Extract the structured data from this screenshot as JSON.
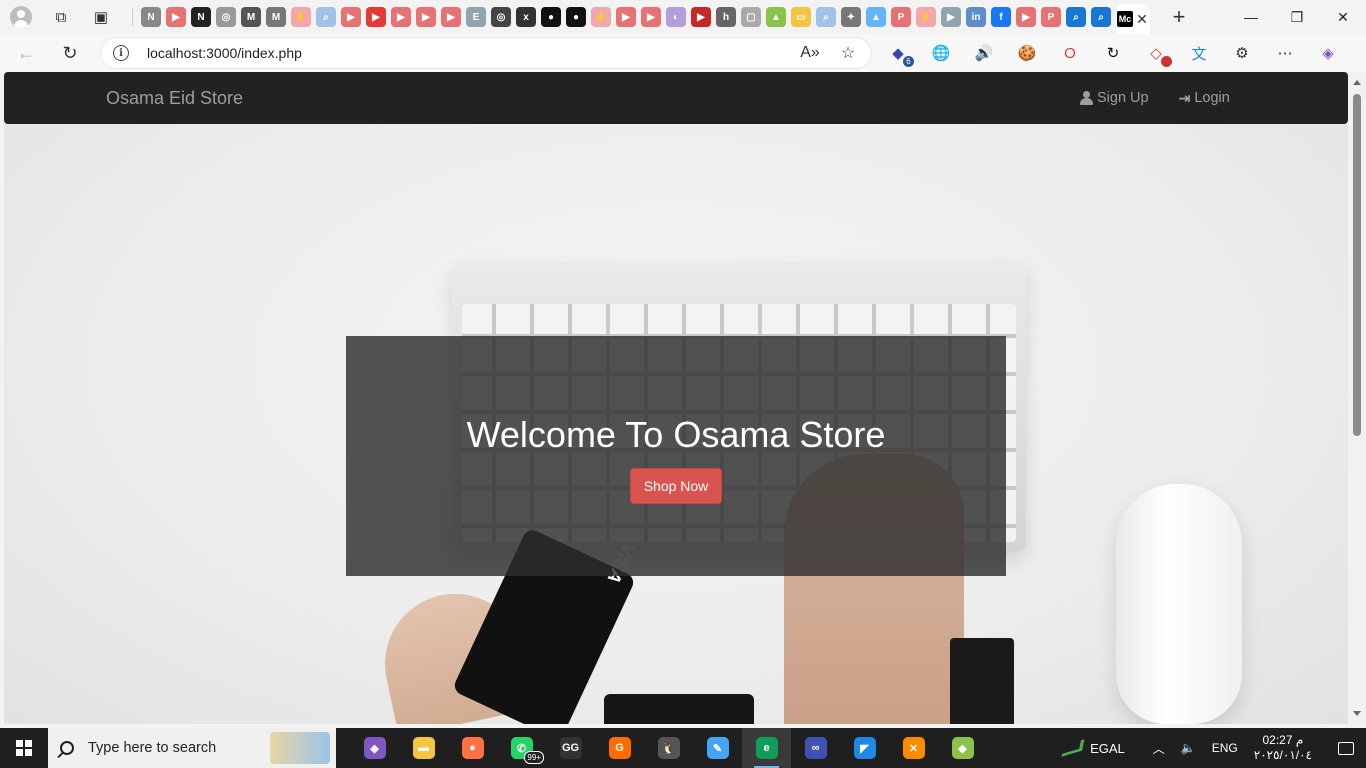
{
  "browser": {
    "url": "localhost:3000/index.php",
    "active_tab_favicon": "Mc",
    "pinned_tabs": [
      {
        "icon": "notion-icon",
        "color": "#888888",
        "glyph": "N"
      },
      {
        "icon": "youtube-icon",
        "color": "#e57373",
        "glyph": "▶"
      },
      {
        "icon": "notion-icon",
        "color": "#222222",
        "glyph": "N"
      },
      {
        "icon": "openai-icon",
        "color": "#999999",
        "glyph": "◎"
      },
      {
        "icon": "medium-icon",
        "color": "#555555",
        "glyph": "M"
      },
      {
        "icon": "medium-icon",
        "color": "#777777",
        "glyph": "M"
      },
      {
        "icon": "app-icon",
        "color": "#f0a8a8",
        "glyph": "⚡"
      },
      {
        "icon": "search-icon",
        "color": "#9ec3e6",
        "glyph": "⌕"
      },
      {
        "icon": "youtube-icon",
        "color": "#e57373",
        "glyph": "▶"
      },
      {
        "icon": "youtube-icon",
        "color": "#e53935",
        "glyph": "▶"
      },
      {
        "icon": "youtube-icon",
        "color": "#e57373",
        "glyph": "▶"
      },
      {
        "icon": "youtube-icon",
        "color": "#e57373",
        "glyph": "▶"
      },
      {
        "icon": "youtube-icon",
        "color": "#e57373",
        "glyph": "▶"
      },
      {
        "icon": "edge-icon",
        "color": "#90a4ae",
        "glyph": "E"
      },
      {
        "icon": "openai-icon",
        "color": "#444444",
        "glyph": "◎"
      },
      {
        "icon": "alx-icon",
        "color": "#333333",
        "glyph": "x"
      },
      {
        "icon": "github-icon",
        "color": "#111111",
        "glyph": "●"
      },
      {
        "icon": "github-icon",
        "color": "#111111",
        "glyph": "●"
      },
      {
        "icon": "app-icon",
        "color": "#f0a8a8",
        "glyph": "⚡"
      },
      {
        "icon": "youtube-icon",
        "color": "#e57373",
        "glyph": "▶"
      },
      {
        "icon": "youtube-icon",
        "color": "#e57373",
        "glyph": "▶"
      },
      {
        "icon": "app-icon",
        "color": "#b39ddb",
        "glyph": "◐"
      },
      {
        "icon": "youtube-icon",
        "color": "#c62828",
        "glyph": "▶"
      },
      {
        "icon": "hashnode-icon",
        "color": "#666666",
        "glyph": "h"
      },
      {
        "icon": "doc-icon",
        "color": "#aaaaaa",
        "glyph": "▢"
      },
      {
        "icon": "drive-icon",
        "color": "#8bc34a",
        "glyph": "▲"
      },
      {
        "icon": "slides-icon",
        "color": "#f4c542",
        "glyph": "▭"
      },
      {
        "icon": "search-icon",
        "color": "#9ec3e6",
        "glyph": "⌕"
      },
      {
        "icon": "app-icon",
        "color": "#777777",
        "glyph": "✦"
      },
      {
        "icon": "drive-icon",
        "color": "#64b5f6",
        "glyph": "▲"
      },
      {
        "icon": "pdf-icon",
        "color": "#e57373",
        "glyph": "P"
      },
      {
        "icon": "app-icon",
        "color": "#f0a8a8",
        "glyph": "⚡"
      },
      {
        "icon": "youtube-icon",
        "color": "#90a4ae",
        "glyph": "▶"
      },
      {
        "icon": "linkedin-icon",
        "color": "#5c8fc7",
        "glyph": "in"
      },
      {
        "icon": "facebook-icon",
        "color": "#1877f2",
        "glyph": "f"
      },
      {
        "icon": "youtube-icon",
        "color": "#e57373",
        "glyph": "▶"
      },
      {
        "icon": "pdf-icon",
        "color": "#e57373",
        "glyph": "P"
      },
      {
        "icon": "search-icon",
        "color": "#1976d2",
        "glyph": "⌕"
      },
      {
        "icon": "search-icon",
        "color": "#1976d2",
        "glyph": "⌕"
      }
    ],
    "extension_icons": [
      {
        "name": "extension-badge-icon",
        "glyph": "◆",
        "color": "#3949ab",
        "badge": "6"
      },
      {
        "name": "globe-icon",
        "glyph": "🌐",
        "color": "#888888",
        "badge": ""
      },
      {
        "name": "audio-icon",
        "glyph": "🔊",
        "color": "#1e88e5",
        "badge": ""
      },
      {
        "name": "cookie-icon",
        "glyph": "🍪",
        "color": "#795548",
        "badge": ""
      },
      {
        "name": "opera-icon",
        "glyph": "O",
        "color": "#e53935",
        "badge": ""
      },
      {
        "name": "refresh-ext-icon",
        "glyph": "↻",
        "color": "#111111",
        "badge": ""
      },
      {
        "name": "ext-red-icon",
        "glyph": "◇",
        "color": "#e53935",
        "badge": "•"
      },
      {
        "name": "translate-icon",
        "glyph": "文",
        "color": "#1e88e5",
        "badge": ""
      },
      {
        "name": "puzzle-icon",
        "glyph": "⚙",
        "color": "#333333",
        "badge": ""
      },
      {
        "name": "more-icon",
        "glyph": "⋯",
        "color": "#333333",
        "badge": ""
      },
      {
        "name": "copilot-icon",
        "glyph": "◈",
        "color": "#7e57c2",
        "badge": ""
      }
    ]
  },
  "site": {
    "brand": "Osama Eid Store",
    "nav": {
      "signup": "Sign Up",
      "login": "Login"
    },
    "hero": {
      "title": "Welcome To Osama Store",
      "button": "Shop Now",
      "card_text": "VISA"
    },
    "colors": {
      "navbar": "#222222",
      "nav_text": "#9d9d9d",
      "button": "#d9534f"
    }
  },
  "taskbar": {
    "search_placeholder": "Type here to search",
    "apps": [
      {
        "name": "copilot-app-icon",
        "color": "#7e57c2",
        "glyph": "◈",
        "active": false
      },
      {
        "name": "file-explorer-icon",
        "color": "#f4c542",
        "glyph": "▬",
        "active": false
      },
      {
        "name": "firefox-icon",
        "color": "#ff7043",
        "glyph": "●",
        "active": false
      },
      {
        "name": "whatsapp-icon",
        "color": "#25d366",
        "glyph": "✆",
        "active": false
      },
      {
        "name": "gg-app-icon",
        "color": "#333333",
        "glyph": "GG",
        "active": false
      },
      {
        "name": "grammarly-icon",
        "color": "#ff6d00",
        "glyph": "G",
        "active": false
      },
      {
        "name": "linux-penguin-icon",
        "color": "#555555",
        "glyph": "🐧",
        "active": false
      },
      {
        "name": "feather-app-icon",
        "color": "#42a5f5",
        "glyph": "✎",
        "active": false
      },
      {
        "name": "edge-browser-icon",
        "color": "#0f9d58",
        "glyph": "e",
        "active": true
      },
      {
        "name": "warp-icon",
        "color": "#3f51b5",
        "glyph": "∞",
        "active": false
      },
      {
        "name": "vscode-icon",
        "color": "#1e88e5",
        "glyph": "◤",
        "active": false
      },
      {
        "name": "xampp-icon",
        "color": "#fb8c00",
        "glyph": "✕",
        "active": false
      },
      {
        "name": "git-icon",
        "color": "#8bc34a",
        "glyph": "◆",
        "active": false
      }
    ],
    "whatsapp_badge": "99+",
    "stock": "EGAL",
    "language": "ENG",
    "time": "02:27 م",
    "date": "٢٠٢٥/٠١/٠٤"
  }
}
